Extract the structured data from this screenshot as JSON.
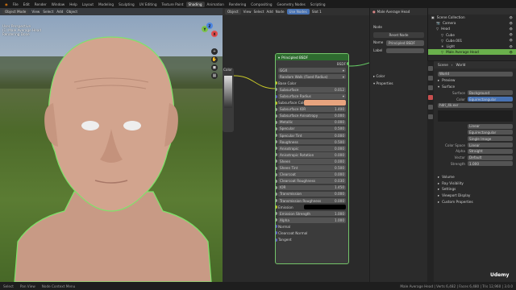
{
  "menu": [
    "File",
    "Edit",
    "Render",
    "Window",
    "Help"
  ],
  "workspace_tabs": [
    "Layout",
    "Modeling",
    "Sculpting",
    "UV Editing",
    "Texture Paint",
    "Shading",
    "Animation",
    "Rendering",
    "Compositing",
    "Geometry Nodes",
    "Scripting"
  ],
  "active_tab": "Shading",
  "viewport": {
    "mode": "Object Mode",
    "menus": [
      "View",
      "Select",
      "Add",
      "Object"
    ],
    "overlay_lines": [
      "User Perspective",
      "(1) Male Average Head",
      "Rendering Done"
    ],
    "gizmo_axes": [
      "X",
      "Y",
      "Z"
    ]
  },
  "node_editor": {
    "menus": [
      "Object",
      "View",
      "Select",
      "Add",
      "Node"
    ],
    "use_nodes_label": "Use Nodes",
    "slot_label": "Slot 1",
    "material_name": "Male Average Head",
    "image_node_label": "Color",
    "bsdf": {
      "title": "Principled BSDF",
      "output_label": "BSDF",
      "distribution": "GGX",
      "subsurface_method": "Random Walk (Fixed Radius)",
      "rows": [
        {
          "label": "Base Color",
          "type": "socket",
          "sock": "y"
        },
        {
          "label": "Subsurface",
          "value": "0.012",
          "sock": "g"
        },
        {
          "label": "Subsurface Radius",
          "type": "dropdown",
          "sock": "p"
        },
        {
          "label": "Subsurface Color",
          "type": "swatch",
          "sock": "y"
        },
        {
          "label": "Subsurface IOR",
          "value": "1.400",
          "sock": "g"
        },
        {
          "label": "Subsurface Anisotropy",
          "value": "0.000",
          "sock": "g"
        },
        {
          "label": "Metallic",
          "value": "0.000",
          "sock": "g"
        },
        {
          "label": "Specular",
          "value": "0.500",
          "sock": "g"
        },
        {
          "label": "Specular Tint",
          "value": "0.000",
          "sock": "g"
        },
        {
          "label": "Roughness",
          "value": "0.500",
          "sock": "g"
        },
        {
          "label": "Anisotropic",
          "value": "0.000",
          "sock": "g"
        },
        {
          "label": "Anisotropic Rotation",
          "value": "0.000",
          "sock": "g"
        },
        {
          "label": "Sheen",
          "value": "0.000",
          "sock": "g"
        },
        {
          "label": "Sheen Tint",
          "value": "0.500",
          "sock": "g"
        },
        {
          "label": "Clearcoat",
          "value": "0.000",
          "sock": "g"
        },
        {
          "label": "Clearcoat Roughness",
          "value": "0.030",
          "sock": "g"
        },
        {
          "label": "IOR",
          "value": "1.450",
          "sock": "g"
        },
        {
          "label": "Transmission",
          "value": "0.000",
          "sock": "g"
        },
        {
          "label": "Transmission Roughness",
          "value": "0.000",
          "sock": "g"
        },
        {
          "label": "Emission",
          "type": "black",
          "sock": "y"
        },
        {
          "label": "Emission Strength",
          "value": "1.000",
          "sock": "g"
        },
        {
          "label": "Alpha",
          "value": "1.000",
          "sock": "g"
        },
        {
          "label": "Normal",
          "type": "socket",
          "sock": "p"
        },
        {
          "label": "Clearcoat Normal",
          "type": "socket",
          "sock": "p"
        },
        {
          "label": "Tangent",
          "type": "socket",
          "sock": "p"
        }
      ],
      "swatch_color": "#e8a47e"
    }
  },
  "node_panel": {
    "section": "Node",
    "reset_label": "Reset Node",
    "name_label": "Name",
    "name_value": "Principled BSDF",
    "label_label": "Label",
    "color_label": "Color",
    "properties_label": "Properties"
  },
  "outliner": {
    "rows": [
      {
        "name": "Scene Collection",
        "sel": false
      },
      {
        "name": "Camera",
        "sel": false
      },
      {
        "name": "Head",
        "sel": false
      },
      {
        "name": "Cube",
        "sel": false
      },
      {
        "name": "Cube.001",
        "sel": false
      },
      {
        "name": "Light",
        "sel": false
      },
      {
        "name": "Male Average Head",
        "sel": true
      }
    ]
  },
  "properties": {
    "header": [
      "Scene",
      "World"
    ],
    "world_name": "World",
    "sections": [
      "Preview",
      "Surface"
    ],
    "surface_label": "Surface",
    "surface_value": "Background",
    "color_label": "Color",
    "color_value": "Equirectangular",
    "image_name": "hdri_4k.exr",
    "rows": [
      {
        "label": "",
        "value": "Linear"
      },
      {
        "label": "",
        "value": "Equirectangular"
      },
      {
        "label": "",
        "value": "Single Image"
      },
      {
        "label": "Color Space",
        "value": "Linear"
      },
      {
        "label": "Alpha",
        "value": "Straight"
      },
      {
        "label": "Vector",
        "value": "Default"
      },
      {
        "label": "Strength",
        "value": "1.000"
      }
    ],
    "collapsed": [
      "Volume",
      "Ray Visibility",
      "Settings",
      "Viewport Display",
      "Custom Properties"
    ]
  },
  "status": {
    "left": [
      "Select",
      "Pan View",
      "Node Context Menu"
    ],
    "right": "Male Average Head | Verts 6,482 | Faces 6,480 | Tris 12,960 | 3.0.0"
  },
  "watermark": "Udemy",
  "colors": {
    "accent_green": "#6ab04c",
    "node_header": "#2e6b2f"
  }
}
